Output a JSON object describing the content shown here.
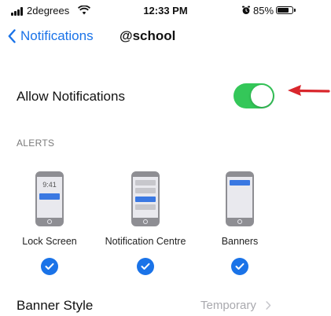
{
  "status_bar": {
    "carrier": "2degrees",
    "time": "12:33 PM",
    "battery_percent": "85%",
    "battery_level": 0.85,
    "icons": [
      "signal-icon",
      "wifi-icon",
      "alarm-icon",
      "battery-icon"
    ]
  },
  "nav": {
    "back_label": "Notifications",
    "title": "@school",
    "back_icon": "chevron-left-icon"
  },
  "allow": {
    "label": "Allow Notifications",
    "enabled": true,
    "toggle_color": "#34c759"
  },
  "annotation": {
    "icon": "red-arrow-icon",
    "color": "#d9262c"
  },
  "alerts": {
    "header": "ALERTS",
    "options": [
      {
        "label": "Lock Screen",
        "checked": true,
        "preview_time": "9:41"
      },
      {
        "label": "Notification Centre",
        "checked": true
      },
      {
        "label": "Banners",
        "checked": true
      }
    ],
    "check_color": "#1a73e8"
  },
  "banner_style": {
    "label": "Banner Style",
    "value": "Temporary",
    "icon": "chevron-right-icon"
  },
  "colors": {
    "accent": "#1a73e8",
    "secondary_text": "#7b7b7b"
  }
}
